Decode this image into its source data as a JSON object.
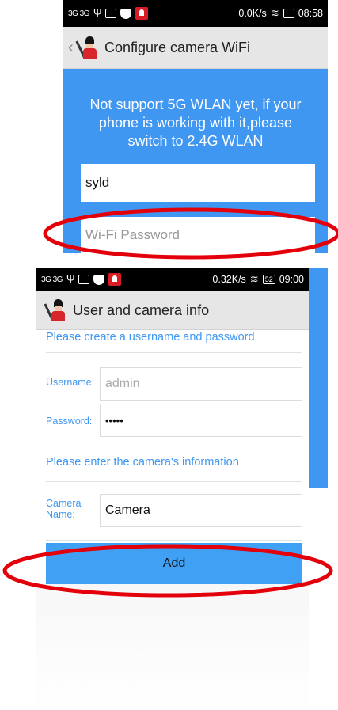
{
  "screen_wifi": {
    "status_bar": {
      "signal": "3G 3G",
      "speed": "0.0K/s",
      "time": "08:58"
    },
    "title": "Configure camera WiFi",
    "notice": "Not support 5G WLAN yet, if your phone is working with it,please switch to 2.4G WLAN",
    "ssid_value": "syld",
    "password_placeholder": "Wi-Fi Password"
  },
  "screen_user": {
    "status_bar": {
      "signal": "3G 3G",
      "speed": "0.32K/s",
      "battery": "52",
      "time": "09:00"
    },
    "title": "User and camera info",
    "section_credentials": "Please create a username and password",
    "username_label": "Username:",
    "username_value": "admin",
    "password_label": "Password:",
    "password_value": "•••••",
    "section_camera": "Please enter the camera's information",
    "camera_name_label": "Camera Name:",
    "camera_name_value": "Camera",
    "add_label": "Add"
  },
  "colors": {
    "accent_blue": "#3f97f2",
    "highlight_red": "#e3000b",
    "appbar_gray": "#e6e6e6"
  },
  "icons": [
    "signal-icon",
    "usb-icon",
    "image-icon",
    "shield-icon",
    "app-logo-icon",
    "wifi-icon",
    "battery-icon",
    "back-chevron-icon"
  ]
}
